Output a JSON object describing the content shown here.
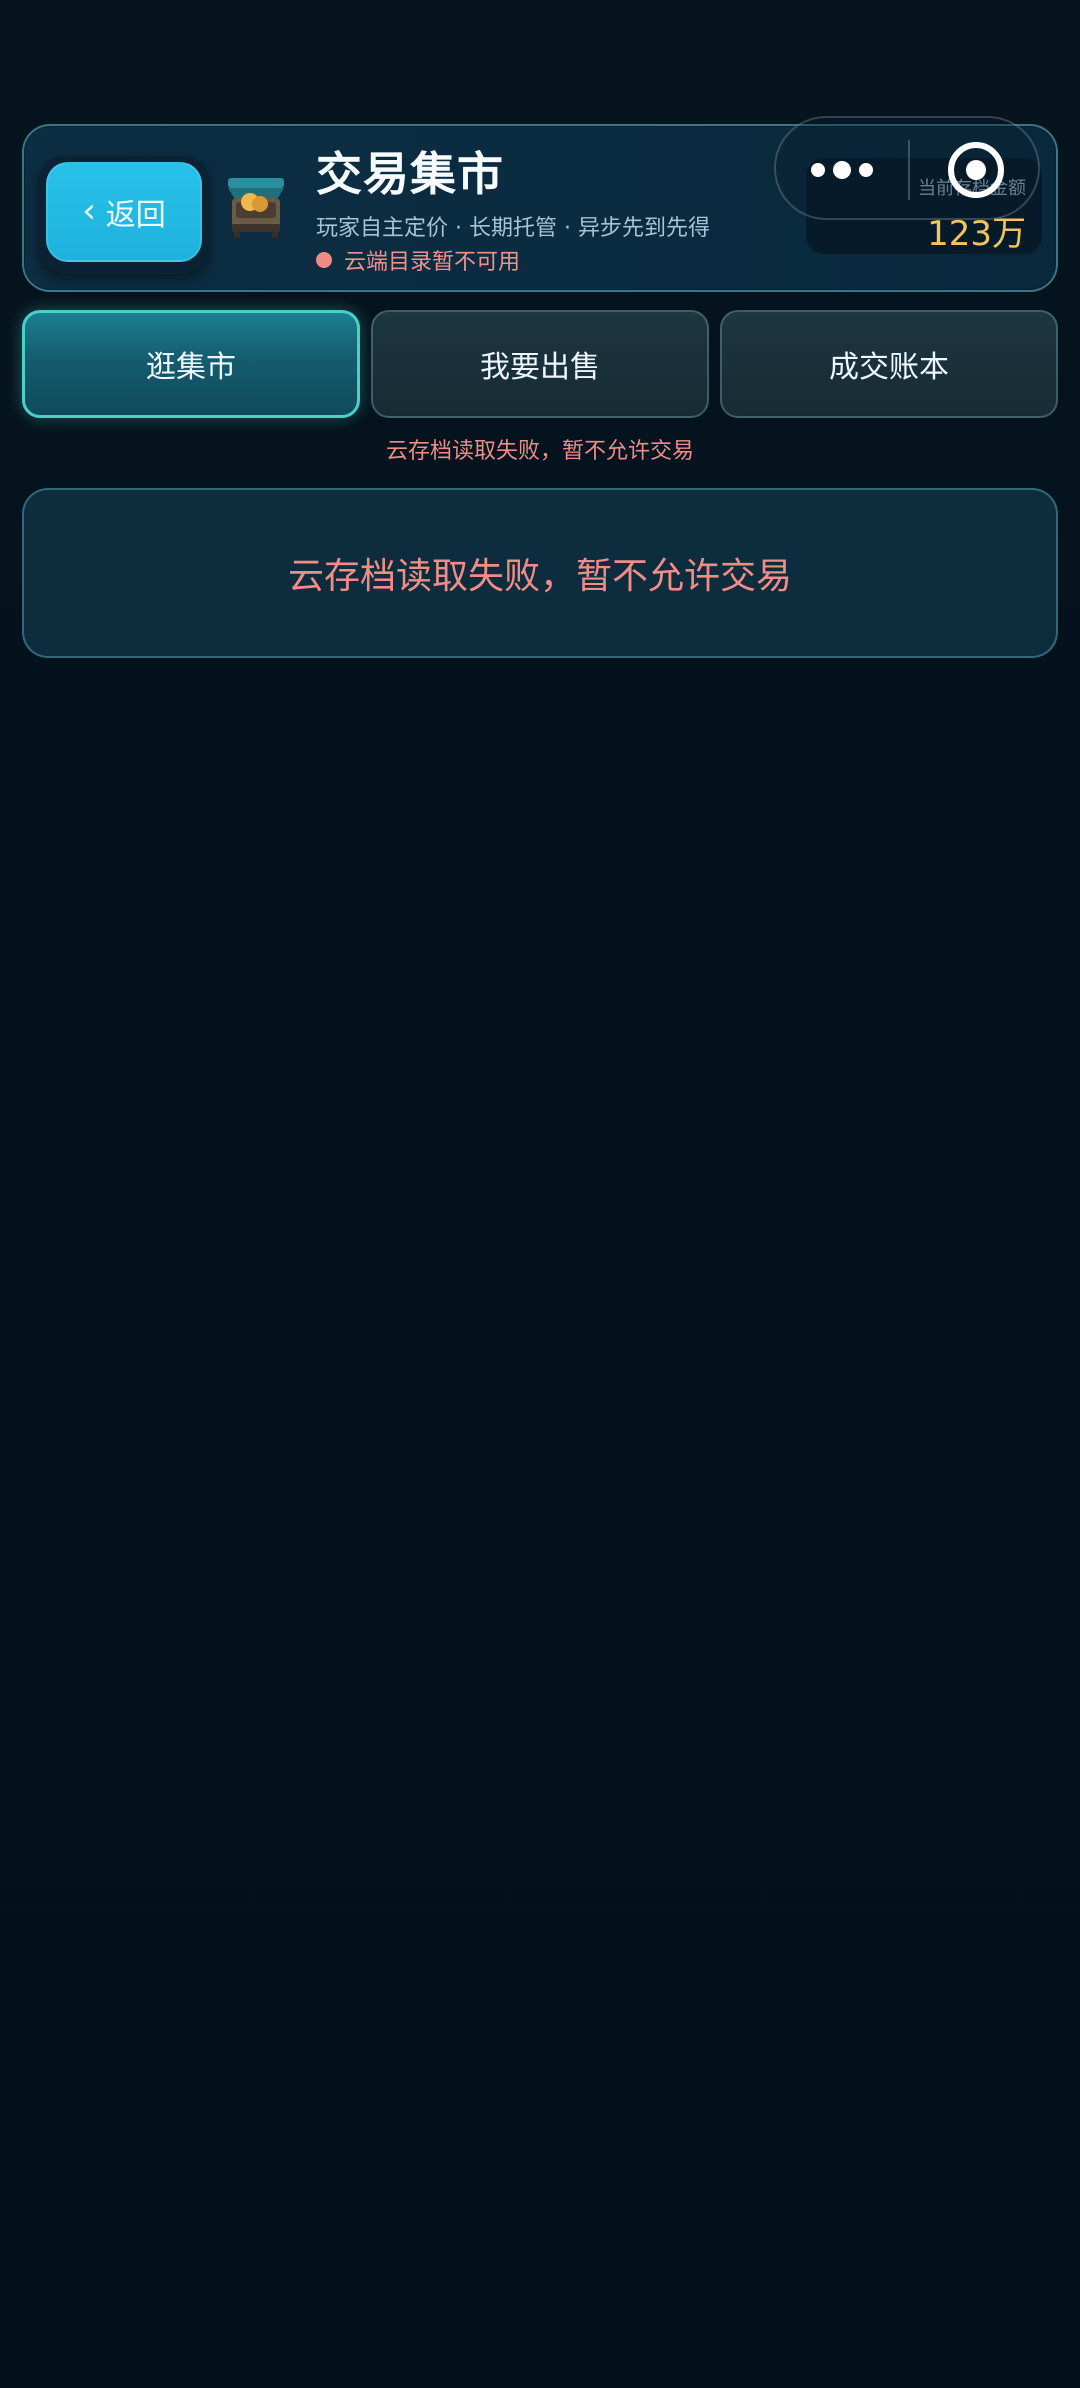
{
  "header": {
    "back_label": "返回",
    "back_chevron": "‹",
    "title": "交易集市",
    "subtitle": "玩家自主定价 · 长期托管 · 异步先到先得",
    "status_text": "云端目录暂不可用",
    "balance_label": "当前存档金额",
    "balance_value": "123万",
    "icon": "market-stall-icon"
  },
  "capsule": {
    "more_icon": "more-dots-icon",
    "close_icon": "target-close-icon"
  },
  "tabs": [
    {
      "label": "逛集市",
      "active": true
    },
    {
      "label": "我要出售",
      "active": false
    },
    {
      "label": "成交账本",
      "active": false
    }
  ],
  "notice_text": "云存档读取失败，暂不允许交易",
  "main": {
    "message": "云存档读取失败，暂不允许交易"
  },
  "colors": {
    "accent": "#1eb2dd",
    "active_tab_border": "#4ad1c3",
    "error": "#f08d86",
    "balance": "#f2c45f",
    "background": "#04121d"
  }
}
